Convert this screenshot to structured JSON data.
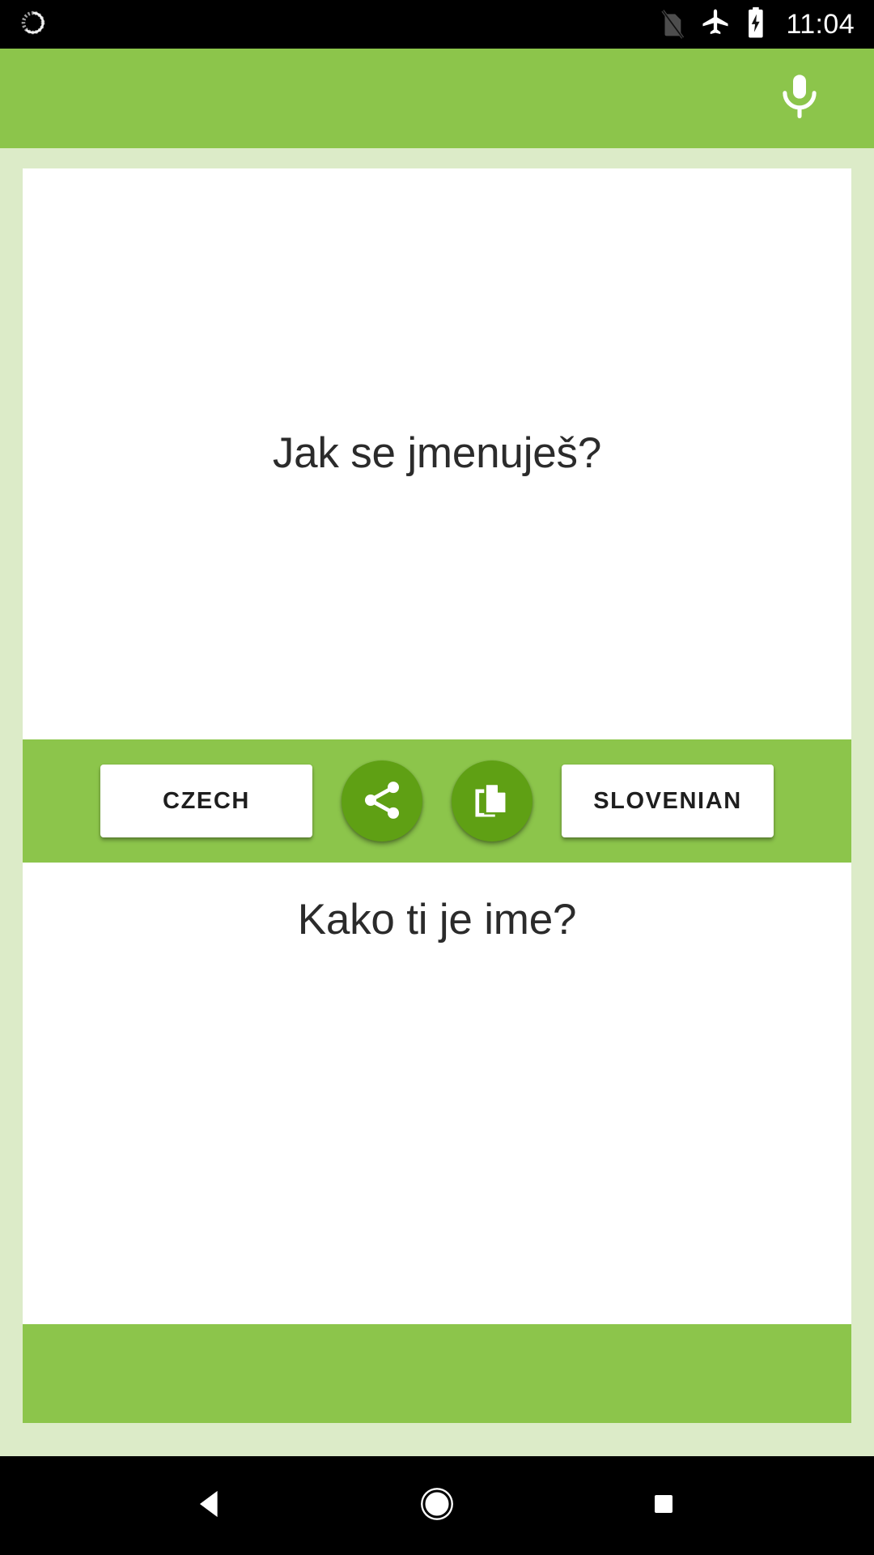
{
  "statusbar": {
    "time": "11:04",
    "icons_left": [
      "sync-notification-icon"
    ],
    "icons_right": [
      "no-sim-card-icon",
      "airplane-mode-icon",
      "battery-charging-icon"
    ]
  },
  "appbar": {
    "mic_icon": "microphone-icon",
    "background_color": "#8cc54b"
  },
  "translation": {
    "source_text": "Jak se jmenuješ?",
    "target_text": "Kako ti je ime?"
  },
  "toolbar": {
    "source_language": "CZECH",
    "target_language": "SLOVENIAN",
    "share_icon": "share-icon",
    "copy_icon": "copy-icon",
    "background_color": "#8cc54b",
    "round_button_color": "#5fa014"
  },
  "navbar": {
    "back_icon": "back-triangle-icon",
    "home_icon": "home-circle-icon",
    "recents_icon": "recents-square-icon"
  },
  "colors": {
    "page_background": "#dcebc8",
    "card_background": "#ffffff",
    "accent_green": "#8cc54b",
    "dark_green": "#5fa014",
    "text_primary": "#2b2b2b"
  }
}
